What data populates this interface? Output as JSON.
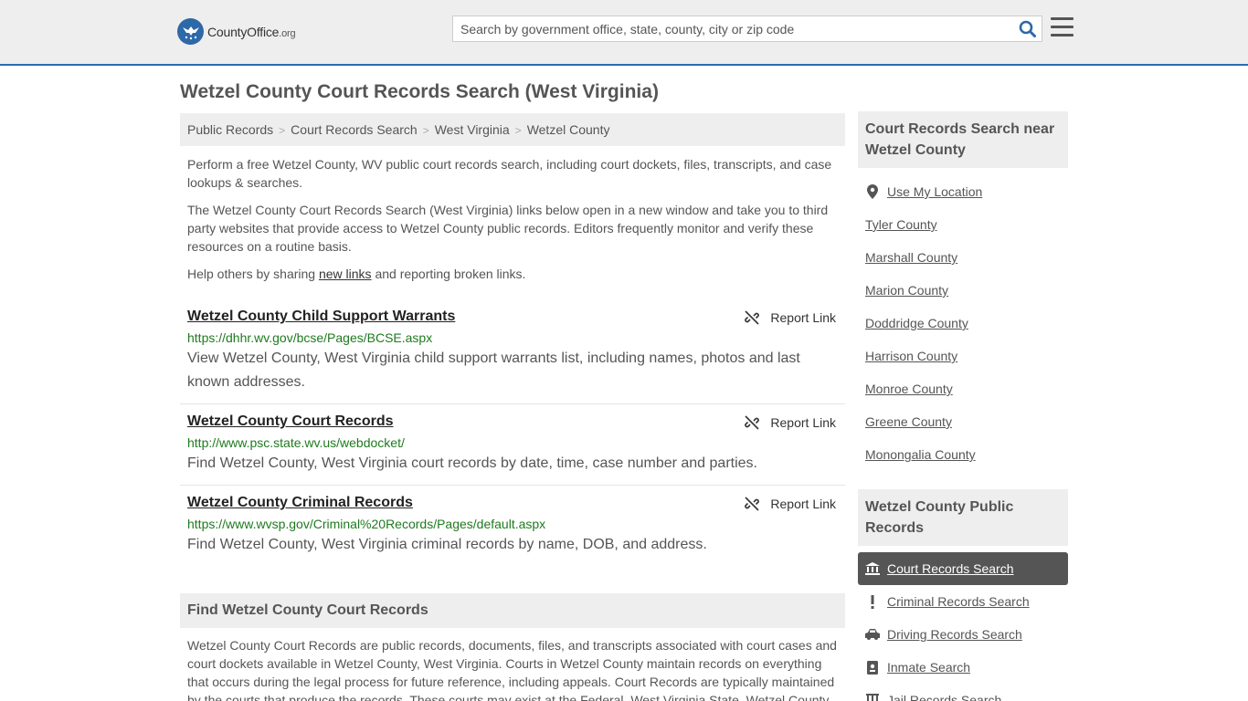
{
  "header": {
    "logo_main": "CountyOffice",
    "logo_tld": ".org",
    "search_placeholder": "Search by government office, state, county, city or zip code"
  },
  "page": {
    "title": "Wetzel County Court Records Search (West Virginia)"
  },
  "breadcrumb": [
    "Public Records",
    "Court Records Search",
    "West Virginia",
    "Wetzel County"
  ],
  "intro": {
    "p1": "Perform a free Wetzel County, WV public court records search, including court dockets, files, transcripts, and case lookups & searches.",
    "p2": "The Wetzel County Court Records Search (West Virginia) links below open in a new window and take you to third party websites that provide access to Wetzel County public records. Editors frequently monitor and verify these resources on a routine basis.",
    "p3_before": "Help others by sharing ",
    "p3_link": "new links",
    "p3_after": " and reporting broken links."
  },
  "report_label": "Report Link",
  "results": [
    {
      "title": "Wetzel County Child Support Warrants",
      "url": "https://dhhr.wv.gov/bcse/Pages/BCSE.aspx",
      "desc": "View Wetzel County, West Virginia child support warrants list, including names, photos and last known addresses."
    },
    {
      "title": "Wetzel County Court Records",
      "url": "http://www.psc.state.wv.us/webdocket/",
      "desc": "Find Wetzel County, West Virginia court records by date, time, case number and parties."
    },
    {
      "title": "Wetzel County Criminal Records",
      "url": "https://www.wvsp.gov/Criminal%20Records/Pages/default.aspx",
      "desc": "Find Wetzel County, West Virginia criminal records by name, DOB, and address."
    }
  ],
  "find_section": {
    "heading": "Find Wetzel County Court Records",
    "text": "Wetzel County Court Records are public records, documents, files, and transcripts associated with court cases and court dockets available in Wetzel County, West Virginia. Courts in Wetzel County maintain records on everything that occurs during the legal process for future reference, including appeals. Court Records are typically maintained by the courts that produce the records. These courts may exist at the Federal, West Virginia State, Wetzel County"
  },
  "sidebar": {
    "nearby_heading": "Court Records Search near Wetzel County",
    "use_location": "Use My Location",
    "nearby": [
      "Tyler County",
      "Marshall County",
      "Marion County",
      "Doddridge County",
      "Harrison County",
      "Monroe County",
      "Greene County",
      "Monongalia County"
    ],
    "public_heading": "Wetzel County Public Records",
    "public_links": [
      {
        "label": "Court Records Search",
        "icon": "courthouse-icon",
        "active": true
      },
      {
        "label": "Criminal Records Search",
        "icon": "exclamation-icon",
        "active": false
      },
      {
        "label": "Driving Records Search",
        "icon": "car-icon",
        "active": false
      },
      {
        "label": "Inmate Search",
        "icon": "id-badge-icon",
        "active": false
      },
      {
        "label": "Jail Records Search",
        "icon": "jail-icon",
        "active": false
      }
    ]
  }
}
